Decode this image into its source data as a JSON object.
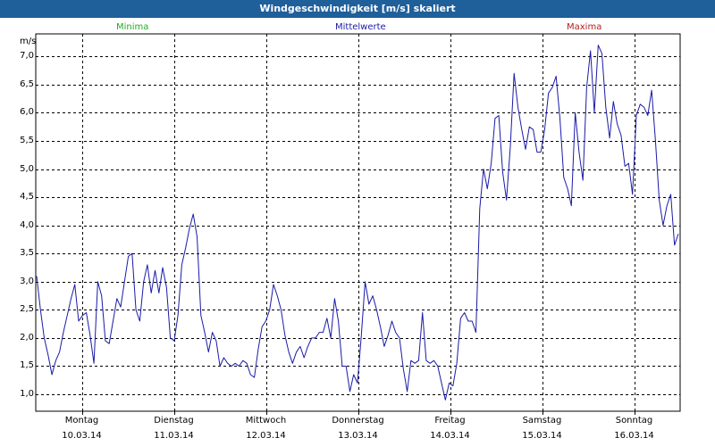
{
  "window": {
    "title": "Windgeschwindigkeit [m/s] skaliert"
  },
  "legend": {
    "min": {
      "label": "Minima",
      "color": "#22aa22"
    },
    "mean": {
      "label": "Mittelwerte",
      "color": "#1a1aa8"
    },
    "max": {
      "label": "Maxima",
      "color": "#b02020"
    }
  },
  "colors": {
    "titlebar": "#1f5f9a",
    "line": "#1a1aa8",
    "grid": "#000000"
  },
  "chart_data": {
    "type": "line",
    "title": "Windgeschwindigkeit [m/s] skaliert",
    "ylabel": "m/s",
    "ylim": [
      0.7,
      7.4
    ],
    "yticks": [
      "1,0",
      "1,5",
      "2,0",
      "2,5",
      "3,0",
      "3,5",
      "4,0",
      "4,5",
      "5,0",
      "5,5",
      "6,0",
      "6,5",
      "7,0"
    ],
    "ytick_values": [
      1.0,
      1.5,
      2.0,
      2.5,
      3.0,
      3.5,
      4.0,
      4.5,
      5.0,
      5.5,
      6.0,
      6.5,
      7.0
    ],
    "grid": true,
    "x_days": [
      {
        "day": "Montag",
        "date": "10.03.14"
      },
      {
        "day": "Dienstag",
        "date": "11.03.14"
      },
      {
        "day": "Mittwoch",
        "date": "12.03.14"
      },
      {
        "day": "Donnerstag",
        "date": "13.03.14"
      },
      {
        "day": "Freitag",
        "date": "14.03.14"
      },
      {
        "day": "Samstag",
        "date": "15.03.14"
      },
      {
        "day": "Sonntag",
        "date": "16.03.14"
      }
    ],
    "series": [
      {
        "name": "Mittelwerte",
        "values": [
          3.1,
          2.5,
          2.0,
          1.7,
          1.35,
          1.6,
          1.75,
          2.1,
          2.4,
          2.7,
          2.95,
          2.3,
          2.4,
          2.45,
          2.05,
          1.55,
          3.0,
          2.75,
          1.95,
          1.9,
          2.3,
          2.7,
          2.55,
          3.0,
          3.45,
          3.5,
          2.5,
          2.3,
          3.0,
          3.3,
          2.8,
          3.2,
          2.8,
          3.25,
          2.9,
          2.0,
          1.95,
          2.4,
          3.3,
          3.6,
          3.95,
          4.2,
          3.8,
          2.4,
          2.1,
          1.75,
          2.1,
          1.95,
          1.5,
          1.65,
          1.55,
          1.5,
          1.55,
          1.5,
          1.6,
          1.55,
          1.35,
          1.3,
          1.8,
          2.2,
          2.3,
          2.5,
          2.95,
          2.75,
          2.5,
          2.05,
          1.75,
          1.55,
          1.75,
          1.85,
          1.65,
          1.85,
          2.0,
          2.0,
          2.1,
          2.1,
          2.35,
          2.0,
          2.7,
          2.3,
          1.5,
          1.5,
          1.05,
          1.35,
          1.2,
          2.05,
          3.0,
          2.6,
          2.75,
          2.5,
          2.2,
          1.85,
          2.05,
          2.3,
          2.1,
          2.0,
          1.45,
          1.05,
          1.6,
          1.55,
          1.6,
          2.45,
          1.6,
          1.55,
          1.6,
          1.5,
          1.2,
          0.9,
          1.2,
          1.15,
          1.55,
          2.35,
          2.45,
          2.3,
          2.3,
          2.1,
          4.3,
          5.0,
          4.65,
          5.1,
          5.9,
          5.95,
          4.95,
          4.45,
          5.4,
          6.7,
          6.1,
          5.7,
          5.35,
          5.75,
          5.7,
          5.3,
          5.3,
          5.7,
          6.35,
          6.45,
          6.65,
          5.9,
          4.85,
          4.65,
          4.35,
          6.0,
          5.3,
          4.8,
          6.45,
          7.1,
          6.0,
          7.2,
          7.05,
          6.1,
          5.55,
          6.2,
          5.8,
          5.6,
          5.05,
          5.1,
          4.55,
          5.95,
          6.15,
          6.1,
          5.95,
          6.4,
          5.5,
          4.45,
          4.0,
          4.35,
          4.55,
          3.65,
          3.85
        ]
      }
    ]
  }
}
